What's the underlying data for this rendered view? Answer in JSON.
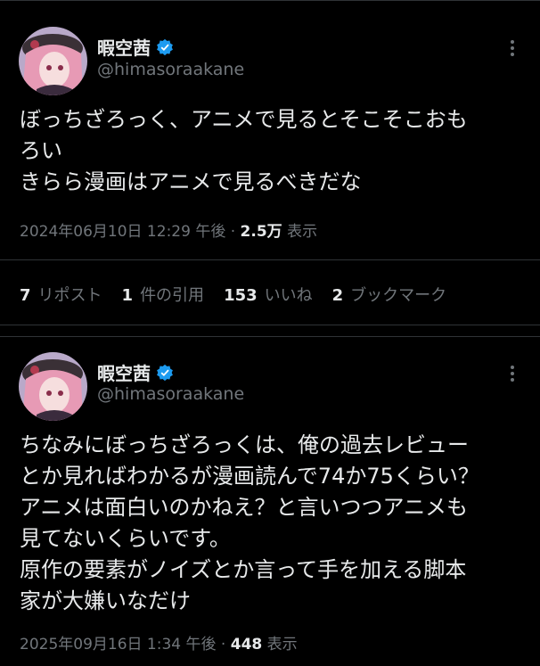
{
  "tweets": [
    {
      "display_name": "暇空茜",
      "handle": "@himasoraakane",
      "text": "ぼっちざろっく、アニメで見るとそこそこおも\nろい\nきらら漫画はアニメで見るべきだな",
      "timestamp": "2024年06月10日 12:29 午後",
      "dot": "·",
      "views": "2.5万",
      "views_label": "表示",
      "stats": [
        {
          "count": "7",
          "label": "リポスト"
        },
        {
          "count": "1",
          "label": "件の引用"
        },
        {
          "count": "153",
          "label": "いいね"
        },
        {
          "count": "2",
          "label": "ブックマーク"
        }
      ]
    },
    {
      "display_name": "暇空茜",
      "handle": "@himasoraakane",
      "text": "ちなみにぼっちざろっくは、俺の過去レビュー\nとか見ればわかるが漫画読んで74か75くらい？\nアニメは面白いのかねえ？と言いつつアニメも\n見てないくらいです。\n原作の要素がノイズとか言って手を加える脚本\n家が大嫌いなだけ",
      "timestamp": "2025年09月16日 1:34 午後",
      "dot": "·",
      "views": "448",
      "views_label": "表示"
    }
  ],
  "colors": {
    "background": "#000000",
    "text": "#e7e9ea",
    "secondary": "#71767b",
    "verified": "#1d9bf0",
    "divider": "#2f3336"
  },
  "icons": [
    "verified-badge-icon",
    "more-options-icon",
    "avatar"
  ]
}
